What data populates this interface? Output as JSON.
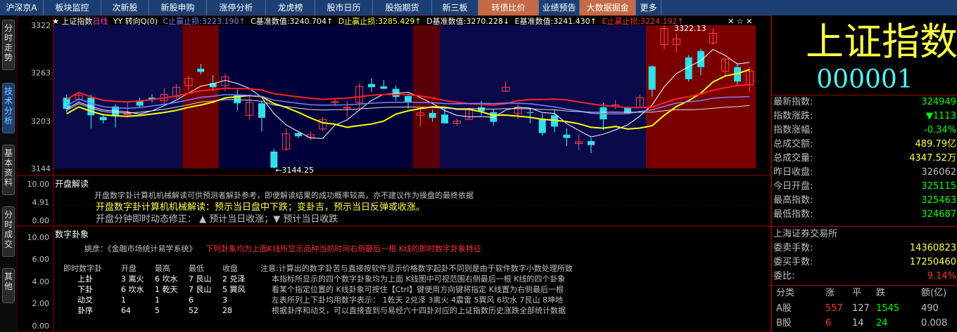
{
  "top_tabs": [
    {
      "label": "沪深京A",
      "hl": false
    },
    {
      "label": "板块监控",
      "hl": false
    },
    {
      "label": "次新股",
      "hl": false
    },
    {
      "label": "新股申购",
      "hl": false
    },
    {
      "label": "涨停分析",
      "hl": false
    },
    {
      "label": "龙虎榜",
      "hl": false
    },
    {
      "label": "股市日历",
      "hl": false
    },
    {
      "label": "股指期货",
      "hl": false
    },
    {
      "label": "新三板",
      "hl": false
    },
    {
      "label": "转债比价",
      "hl": true
    },
    {
      "label": "业绩预告",
      "hl": false
    },
    {
      "label": "大数据掘金",
      "hl": true
    },
    {
      "label": "更多",
      "hl": false
    }
  ],
  "side_tabs": [
    {
      "label": "分时走势",
      "active": false
    },
    {
      "label": "技术分析",
      "active": true
    },
    {
      "label": "基本资料",
      "active": false
    },
    {
      "label": "分时成交",
      "active": false
    },
    {
      "label": "其他",
      "active": false
    }
  ],
  "info_bar": {
    "star": "★",
    "symbol": "上证指数",
    "period": "日线",
    "indicator": "YY 转向Q(0)",
    "c_label": "C止赢止损:",
    "c_value": "3223.190↑",
    "cb_label": "C基准数值:",
    "cb_value": "3240.704↑",
    "d_label": "D止赢止损:",
    "d_value": "3285.429↑",
    "db_label": "D基准数值:",
    "db_value": "3270.228↓",
    "eb_label": "E基准数值:",
    "eb_value": "3241.430↑",
    "e_label": "E止赢止损:",
    "e_value": "3224.192↑",
    "icons": "✕ ☆ ✕"
  },
  "chart_data": {
    "type": "candlestick",
    "y_ticks": [
      "3322",
      "3263",
      "3203",
      "3144"
    ],
    "ylim": [
      3144,
      3322
    ],
    "high_label": "3322.13",
    "low_label": "←3144.25",
    "candles": [
      [
        3232,
        3218,
        3236,
        3214
      ],
      [
        3230,
        3235,
        3238,
        3226
      ],
      [
        3232,
        3210,
        3236,
        3194
      ],
      [
        3208,
        3204,
        3212,
        3200
      ],
      [
        3221,
        3210,
        3224,
        3195
      ],
      [
        3212,
        3212,
        3226,
        3207
      ],
      [
        3228,
        3222,
        3232,
        3219
      ],
      [
        3232,
        3230,
        3236,
        3226
      ],
      [
        3228,
        3236,
        3244,
        3224
      ],
      [
        3233,
        3245,
        3249,
        3231
      ],
      [
        3247,
        3256,
        3259,
        3241
      ],
      [
        3268,
        3264,
        3274,
        3261
      ],
      [
        3250,
        3245,
        3260,
        3240
      ],
      [
        3247,
        3258,
        3262,
        3240
      ],
      [
        3236,
        3225,
        3242,
        3216
      ],
      [
        3210,
        3226,
        3236,
        3204
      ],
      [
        3225,
        3207,
        3228,
        3190
      ],
      [
        3165,
        3145,
        3168,
        3144
      ],
      [
        3168,
        3187,
        3194,
        3166
      ],
      [
        3188,
        3184,
        3189,
        3182
      ],
      [
        3183,
        3186,
        3190,
        3179
      ],
      [
        3193,
        3205,
        3208,
        3190
      ],
      [
        3226,
        3227,
        3231,
        3221
      ],
      [
        3220,
        3220,
        3228,
        3207
      ],
      [
        3226,
        3246,
        3250,
        3219
      ],
      [
        3249,
        3245,
        3256,
        3239
      ],
      [
        3246,
        3243,
        3254,
        3243
      ],
      [
        3243,
        3233,
        3247,
        3228
      ],
      [
        3234,
        3227,
        3237,
        3218
      ],
      [
        3210,
        3213,
        3220,
        3196
      ],
      [
        3213,
        3207,
        3217,
        3202
      ],
      [
        3211,
        3200,
        3219,
        3201
      ],
      [
        3200,
        3203,
        3206,
        3197
      ],
      [
        3205,
        3218,
        3220,
        3205
      ],
      [
        3220,
        3215,
        3228,
        3210
      ],
      [
        3214,
        3202,
        3218,
        3197
      ],
      [
        3240,
        3245,
        3252,
        3239
      ],
      [
        3212,
        3220,
        3224,
        3205
      ],
      [
        3214,
        3213,
        3218,
        3200
      ],
      [
        3206,
        3188,
        3212,
        3185
      ],
      [
        3210,
        3196,
        3216,
        3189
      ],
      [
        3186,
        3182,
        3194,
        3172
      ],
      [
        3175,
        3177,
        3186,
        3167
      ],
      [
        3178,
        3173,
        3182,
        3163
      ],
      [
        3220,
        3205,
        3226,
        3192
      ],
      [
        3221,
        3223,
        3229,
        3218
      ],
      [
        3220,
        3213,
        3221,
        3215
      ],
      [
        3220,
        3232,
        3236,
        3220
      ],
      [
        3271,
        3242,
        3272,
        3233
      ],
      [
        3298,
        3318,
        3322,
        3292
      ],
      [
        3298,
        3305,
        3312,
        3288
      ],
      [
        3282,
        3255,
        3285,
        3252
      ],
      [
        3290,
        3270,
        3293,
        3260
      ],
      [
        3300,
        3312,
        3318,
        3298
      ],
      [
        3265,
        3280,
        3282,
        3258
      ],
      [
        3270,
        3252,
        3275,
        3246
      ],
      [
        3248,
        3265,
        3270,
        3240
      ]
    ],
    "red_zones": [
      [
        10,
        12
      ],
      [
        48,
        56
      ]
    ],
    "maroon_zone": [
      29,
      30
    ]
  },
  "zones": {
    "band_label": ""
  },
  "panel2": {
    "title": "开盘解读",
    "y_ticks": [
      "10.00",
      "4.91",
      "0.00"
    ],
    "line1": "开盘数字卦计算机机械解读可供预测者解卦参考，即便解读结果的成功概率较高，亦不建议作为操盘的最终依据",
    "line2": "开盘数字卦计算机机械解读：预示当日盘中下跌；变卦吉，预示当日反弹或收涨。",
    "line3": "开盘分钟即时动态修正：  ▲ 预计当日收涨；▼ 预计当日收跌"
  },
  "panel3": {
    "title": "数字卦象",
    "y_ticks": [
      "10.00",
      "6.00",
      "4.00",
      "2.00",
      "0.00"
    ],
    "source_label": "姚彦：《金融市场统计易学系统》",
    "source_note": "下列卦象均为上面K线所显示品种当前时间右侧最后一根 K线的即时数字卦象特征",
    "table_head": [
      "即时数字卦",
      "开盘",
      "最高",
      "最低",
      "收盘"
    ],
    "table_rows": [
      [
        "上卦",
        "3 离火",
        "6 坎水",
        "7 艮山",
        "2 兑泽"
      ],
      [
        "下卦",
        "6 坎水",
        "1 乾天",
        "7 艮山",
        "5 巽风"
      ],
      [
        "动爻",
        "1",
        "1",
        "6",
        "3"
      ],
      [
        "卦序",
        "64",
        "5",
        "52",
        "28"
      ]
    ],
    "notes": [
      "注意:计算出的数字卦苦与直接按软件显示价格数字起卦不同则是由于软件数字小数处理所致",
      "本指标所显示的四个数字卦象均为上面 K线图中可视范围右侧最后一根 K线的四个卦象",
      "看某个指定位置的 K线卦象可按住【Ctrl】键使用方向键将指定 K线置为右侧最后一根",
      "左表所列上下卦均用数字表示：  1乾天 2兑泽 3离火 4震雷 5巽风 6坎水 7艮山 8坤地",
      "根据卦序和动爻，可以直接查到与易经六十四卦对应的上证指数历史涨跌全部统计数据"
    ]
  },
  "right": {
    "name": "上证指数",
    "code": "000001",
    "quotes": [
      {
        "label": "最新指数:",
        "value": "324949",
        "color": "#00ff00"
      },
      {
        "label": "指数涨跌:",
        "value": "▼1113",
        "color": "#00ff00"
      },
      {
        "label": "指数涨幅:",
        "value": "-0.34%",
        "color": "#00ff00"
      },
      {
        "label": "总成交额:",
        "value": "489.79亿",
        "color": "#ffff44"
      },
      {
        "label": "总成交量:",
        "value": "4347.52万",
        "color": "#ffff44"
      },
      {
        "label": "昨日收盘:",
        "value": "326062",
        "color": "#c0c0c0"
      },
      {
        "label": "今日开盘:",
        "value": "325115",
        "color": "#00ff00"
      },
      {
        "label": "最高指数:",
        "value": "325463",
        "color": "#00ff00"
      },
      {
        "label": "最低指数:",
        "value": "324687",
        "color": "#00ff00"
      }
    ],
    "exchange": "上海证券交易所",
    "orders": [
      {
        "label": "委卖手数:",
        "value": "14360823",
        "color": "#ffff44"
      },
      {
        "label": "委买手数:",
        "value": "17250460",
        "color": "#ffff44"
      },
      {
        "label": "委比:",
        "value": "9.14%",
        "color": "#ff3030"
      }
    ],
    "breadth_head": [
      "分类",
      "涨",
      "平",
      "跌",
      "额(亿)"
    ],
    "breadth_rows": [
      [
        "A股",
        "557",
        "127",
        "1545",
        "490"
      ],
      [
        "B股",
        "6",
        "14",
        "24",
        "0.008"
      ]
    ]
  }
}
